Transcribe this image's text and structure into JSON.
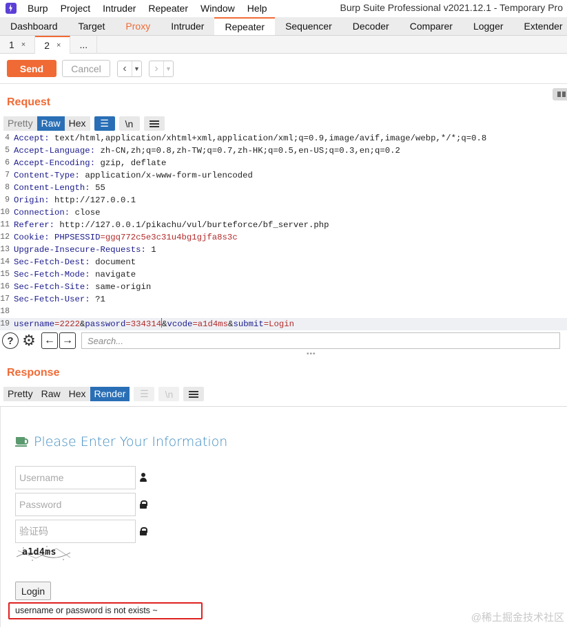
{
  "titlebar": {
    "menu": [
      "Burp",
      "Project",
      "Intruder",
      "Repeater",
      "Window",
      "Help"
    ],
    "window_title": "Burp Suite Professional v2021.12.1 - Temporary Pro"
  },
  "main_tabs": [
    "Dashboard",
    "Target",
    "Proxy",
    "Intruder",
    "Repeater",
    "Sequencer",
    "Decoder",
    "Comparer",
    "Logger",
    "Extender"
  ],
  "sub_tabs": [
    {
      "label": "1",
      "close": "×"
    },
    {
      "label": "2",
      "close": "×"
    },
    {
      "label": "..."
    }
  ],
  "toolbar": {
    "send_label": "Send",
    "cancel_label": "Cancel"
  },
  "request": {
    "title": "Request",
    "modes": [
      "Pretty",
      "Raw",
      "Hex"
    ],
    "active_mode": "Raw",
    "newline_label": "\\n",
    "lines": [
      {
        "n": "4",
        "key": "Accept:",
        "value": " text/html,application/xhtml+xml,application/xml;q=0.9,image/avif,image/webp,*/*;q=0.8"
      },
      {
        "n": "5",
        "key": "Accept-Language:",
        "value": " zh-CN,zh;q=0.8,zh-TW;q=0.7,zh-HK;q=0.5,en-US;q=0.3,en;q=0.2"
      },
      {
        "n": "6",
        "key": "Accept-Encoding:",
        "value": " gzip, deflate"
      },
      {
        "n": "7",
        "key": "Content-Type:",
        "value": " application/x-www-form-urlencoded"
      },
      {
        "n": "8",
        "key": "Content-Length:",
        "value": " 55"
      },
      {
        "n": "9",
        "key": "Origin:",
        "value": " http://127.0.0.1"
      },
      {
        "n": "10",
        "key": "Connection:",
        "value": " close"
      },
      {
        "n": "11",
        "key": "Referer:",
        "value": " http://127.0.0.1/pikachu/vul/burteforce/bf_server.php"
      },
      {
        "n": "12",
        "key": "Cookie:",
        "cookie_name": " PHPSESSID",
        "cookie_value": "=ggq772c5e3c31u4bg1gjfa8s3c"
      },
      {
        "n": "13",
        "key": "Upgrade-Insecure-Requests:",
        "value": " 1"
      },
      {
        "n": "14",
        "key": "Sec-Fetch-Dest:",
        "value": " document"
      },
      {
        "n": "15",
        "key": "Sec-Fetch-Mode:",
        "value": " navigate"
      },
      {
        "n": "16",
        "key": "Sec-Fetch-Site:",
        "value": " same-origin"
      },
      {
        "n": "17",
        "key": "Sec-Fetch-User:",
        "value": " ?1"
      },
      {
        "n": "18",
        "key": "",
        "value": ""
      }
    ],
    "body_line": {
      "n": "19",
      "p1": "username",
      "v1": "2222",
      "p2": "password",
      "v2": "334314",
      "p3": "vcode",
      "v3": "a1d4ms",
      "p4": "submit",
      "v4": "Login",
      "eq": "=",
      "amp": "&"
    },
    "search_placeholder": "Search...",
    "help_glyph": "?"
  },
  "response": {
    "title": "Response",
    "modes": [
      "Pretty",
      "Raw",
      "Hex",
      "Render"
    ],
    "active_mode": "Render",
    "newline_label": "\\n",
    "render": {
      "heading": "Please Enter Your Information",
      "username_placeholder": "Username",
      "password_placeholder": "Password",
      "vcode_placeholder": "验证码",
      "captcha_text": "a1d4ms",
      "login_label": "Login",
      "message": "username or password is not exists ~"
    }
  },
  "watermark": "@稀土掘金技术社区",
  "colors": {
    "accent": "#f06a35",
    "mode_active": "#2a6fb6",
    "notice_border": "#e02020"
  }
}
